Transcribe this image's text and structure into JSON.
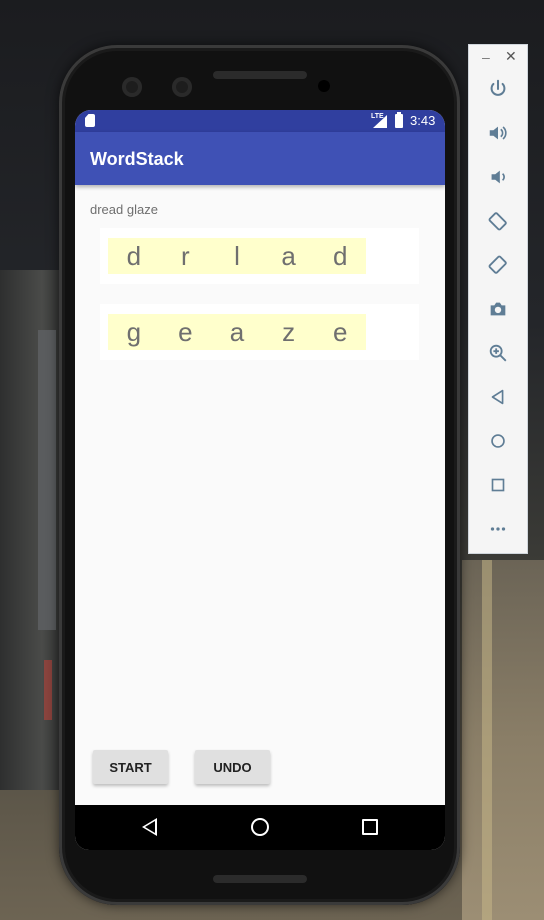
{
  "status_bar": {
    "time": "3:43",
    "network": "LTE"
  },
  "app": {
    "title": "WordStack"
  },
  "hint_text": "dread glaze",
  "stacks": [
    {
      "letters": [
        "d",
        "r",
        "l",
        "a",
        "d"
      ]
    },
    {
      "letters": [
        "g",
        "e",
        "a",
        "z",
        "e"
      ]
    }
  ],
  "buttons": {
    "start": "START",
    "undo": "UNDO"
  },
  "emulator_panel": {
    "minimize": "–",
    "close": "✕",
    "controls": [
      "power-icon",
      "volume-up-icon",
      "volume-down-icon",
      "rotate-left-icon",
      "rotate-right-icon",
      "camera-icon",
      "zoom-icon",
      "back-icon",
      "home-icon",
      "overview-icon",
      "more-icon"
    ]
  },
  "colors": {
    "status_bar": "#303f9f",
    "app_bar": "#3f51b5",
    "tile_background": "#ffffcc",
    "letter": "#6f6f6f",
    "button": "#e0e0e0",
    "panel_icon": "#5f7d95"
  }
}
